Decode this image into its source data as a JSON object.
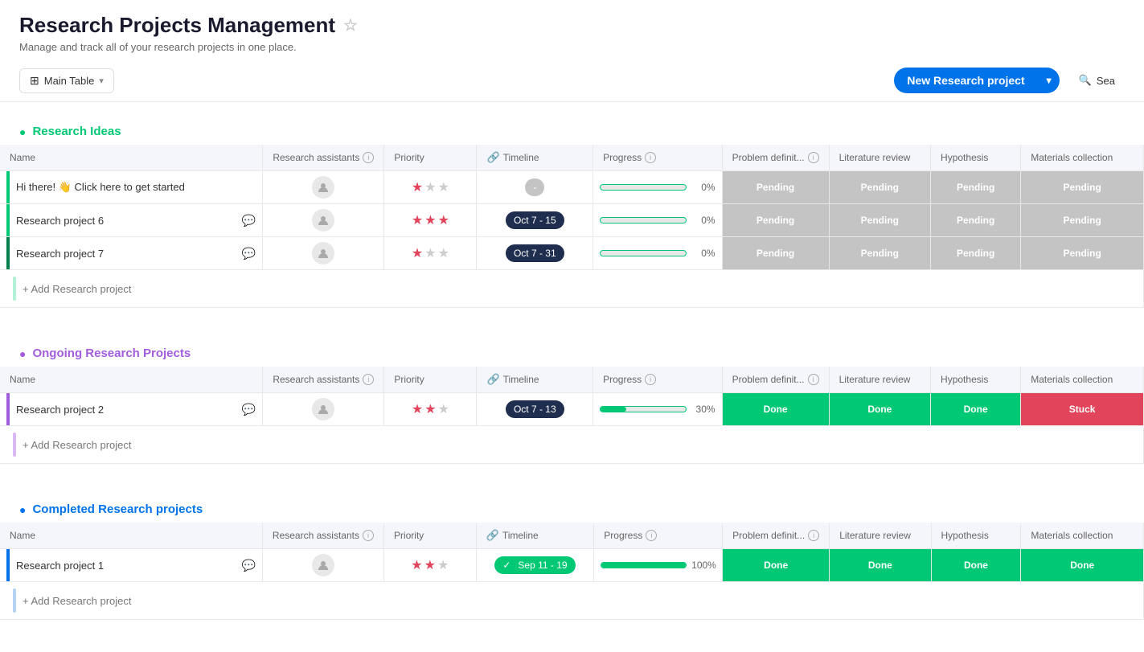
{
  "header": {
    "title": "Research Projects Management",
    "subtitle": "Manage and track all of your research projects in one place.",
    "star_label": "★"
  },
  "toolbar": {
    "main_table_label": "Main Table",
    "new_project_label": "New Research project",
    "search_label": "Sea"
  },
  "columns": {
    "name": "Name",
    "assistants": "Research assistants",
    "priority": "Priority",
    "timeline": "Timeline",
    "progress": "Progress",
    "problem": "Problem definit...",
    "literature": "Literature review",
    "hypothesis": "Hypothesis",
    "materials": "Materials collection"
  },
  "sections": [
    {
      "id": "ideas",
      "title": "Research Ideas",
      "color_class": "green",
      "toggle_icon": "▼",
      "rows": [
        {
          "id": "starter",
          "name": "Hi there! 👋 Click here to get started",
          "bar_color": "green",
          "has_chat": false,
          "has_wave": true,
          "assistant": "",
          "priority_stars": [
            1,
            0,
            0
          ],
          "timeline": "-",
          "timeline_class": "empty-badge",
          "progress_pct": 0,
          "progress_label": "0%",
          "statuses": [
            "Pending",
            "Pending",
            "Pending",
            "Pending"
          ]
        },
        {
          "id": "project6",
          "name": "Research project 6",
          "bar_color": "green",
          "has_chat": true,
          "assistant": "",
          "priority_stars": [
            1,
            1,
            1
          ],
          "timeline": "Oct 7 - 15",
          "timeline_class": "dark",
          "progress_pct": 0,
          "progress_label": "0%",
          "statuses": [
            "Pending",
            "Pending",
            "Pending",
            "Pending"
          ]
        },
        {
          "id": "project7",
          "name": "Research project 7",
          "bar_color": "dark-green",
          "has_chat": true,
          "assistant": "",
          "priority_stars": [
            1,
            0,
            0
          ],
          "timeline": "Oct 7 - 31",
          "timeline_class": "dark",
          "progress_pct": 0,
          "progress_label": "0%",
          "statuses": [
            "Pending",
            "Pending",
            "Pending",
            "Pending"
          ]
        }
      ],
      "add_label": "+ Add Research project",
      "bar_color_class": "green"
    },
    {
      "id": "ongoing",
      "title": "Ongoing Research Projects",
      "color_class": "purple",
      "toggle_icon": "▼",
      "rows": [
        {
          "id": "project2",
          "name": "Research project 2",
          "bar_color": "purple",
          "has_chat": true,
          "assistant": "",
          "priority_stars": [
            1,
            1,
            0
          ],
          "timeline": "Oct 7 - 13",
          "timeline_class": "dark",
          "progress_pct": 30,
          "progress_label": "30%",
          "statuses": [
            "Done",
            "Done",
            "Done",
            "Stuck"
          ]
        }
      ],
      "add_label": "+ Add Research project",
      "bar_color_class": "purple"
    },
    {
      "id": "completed",
      "title": "Completed Research projects",
      "color_class": "blue",
      "toggle_icon": "▼",
      "rows": [
        {
          "id": "project1",
          "name": "Research project 1",
          "bar_color": "blue",
          "has_chat": true,
          "assistant": "",
          "priority_stars": [
            1,
            1,
            0
          ],
          "timeline": "Sep 11 - 19",
          "timeline_class": "green-badge",
          "timeline_icon": "✓",
          "progress_pct": 100,
          "progress_label": "100%",
          "statuses": [
            "Done",
            "Done",
            "Done",
            "Done"
          ]
        }
      ],
      "add_label": "+ Add Research project",
      "bar_color_class": "blue"
    }
  ]
}
